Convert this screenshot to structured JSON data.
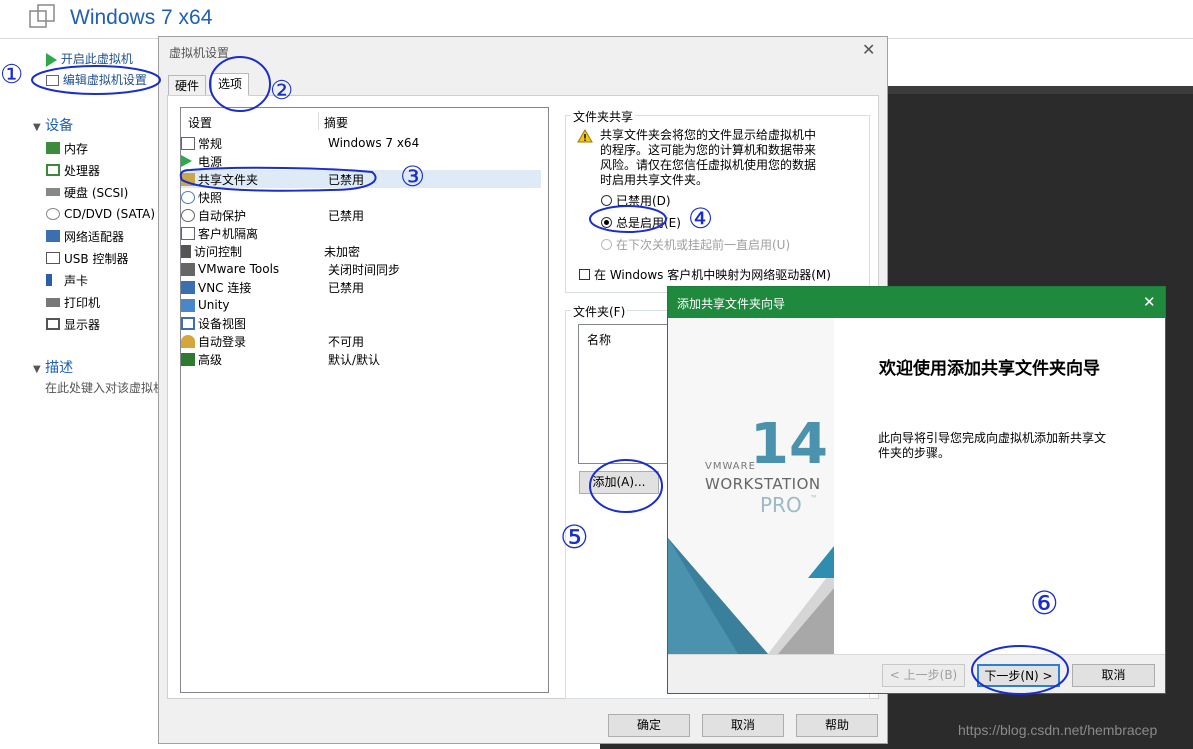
{
  "vm": {
    "title": "Windows 7 x64",
    "actions": [
      "开启此虚拟机",
      "编辑虚拟机设置"
    ],
    "devices_header": "设备",
    "devices": [
      "内存",
      "处理器",
      "硬盘 (SCSI)",
      "CD/DVD (SATA)",
      "网络适配器",
      "USB 控制器",
      "声卡",
      "打印机",
      "显示器"
    ],
    "desc_header": "描述",
    "desc_placeholder": "在此处键入对该虚拟机"
  },
  "settings": {
    "title": "虚拟机设置",
    "close": "✕",
    "tabs": [
      "硬件",
      "选项"
    ],
    "col_settings": "设置",
    "col_summary": "摘要",
    "rows": [
      {
        "name": "常规",
        "summary": "Windows 7 x64",
        "icon": "general-icon"
      },
      {
        "name": "电源",
        "summary": "",
        "icon": "power-icon"
      },
      {
        "name": "共享文件夹",
        "summary": "已禁用",
        "icon": "shared-folder-icon"
      },
      {
        "name": "快照",
        "summary": "",
        "icon": "snapshot-icon"
      },
      {
        "name": "自动保护",
        "summary": "已禁用",
        "icon": "autoprotect-icon"
      },
      {
        "name": "客户机隔离",
        "summary": "",
        "icon": "isolation-icon"
      },
      {
        "name": "访问控制",
        "summary": "未加密",
        "icon": "access-control-icon"
      },
      {
        "name": "VMware Tools",
        "summary": "关闭时间同步",
        "icon": "vmware-tools-icon"
      },
      {
        "name": "VNC 连接",
        "summary": "已禁用",
        "icon": "vnc-icon"
      },
      {
        "name": "Unity",
        "summary": "",
        "icon": "unity-icon"
      },
      {
        "name": "设备视图",
        "summary": "",
        "icon": "device-view-icon"
      },
      {
        "name": "自动登录",
        "summary": "不可用",
        "icon": "autologin-icon"
      },
      {
        "name": "高级",
        "summary": "默认/默认",
        "icon": "advanced-icon"
      }
    ],
    "sharing_group": "文件夹共享",
    "warning": [
      "共享文件夹会将您的文件显示给虚拟机中",
      "的程序。这可能为您的计算机和数据带来",
      "风险。请仅在您信任虚拟机使用您的数据",
      "时启用共享文件夹。"
    ],
    "opt_disabled": "已禁用(D)",
    "opt_always": "总是启用(E)",
    "opt_until": "在下次关机或挂起前一直启用(U)",
    "map_drive": "在 Windows 客户机中映射为网络驱动器(M)",
    "folders_group": "文件夹(F)",
    "folders_col": "名称",
    "add_btn": "添加(A)...",
    "ok": "确定",
    "cancel": "取消",
    "help": "帮助"
  },
  "wizard": {
    "title": "添加共享文件夹向导",
    "close": "✕",
    "brand_vmware": "VMWARE",
    "brand_workstation": "WORKSTATION",
    "brand_pro": "PRO",
    "brand_tm": "™",
    "brand_version": "14",
    "heading": "欢迎使用添加共享文件夹向导",
    "text": [
      "此向导将引导您完成向虚拟机添加新共享文",
      "件夹的步骤。"
    ],
    "back": "< 上一步(B)",
    "next": "下一步(N) >",
    "cancel": "取消"
  },
  "annotations": [
    "①",
    "②",
    "③",
    "④",
    "⑤",
    "⑥"
  ],
  "watermark": "https://blog.csdn.net/hembracep",
  "colors": {
    "wizard_green": "#1f8a3d",
    "annotation_blue": "#1a2ecc",
    "vm_blue": "#1f5fb5"
  }
}
